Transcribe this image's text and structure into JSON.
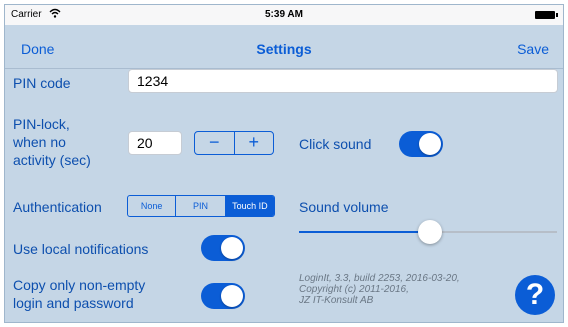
{
  "statusbar": {
    "carrier": "Carrier",
    "time": "5:39 AM"
  },
  "nav": {
    "left": "Done",
    "title": "Settings",
    "right": "Save"
  },
  "pin_code": {
    "label": "PIN code",
    "value": "1234"
  },
  "pin_lock": {
    "label_lines": [
      "PIN-lock,",
      "when no",
      "activity (sec)"
    ],
    "value": "20",
    "minus": "−",
    "plus": "+"
  },
  "click_sound": {
    "label": "Click sound",
    "on": true
  },
  "authentication": {
    "label": "Authentication",
    "options": [
      "None",
      "PIN",
      "Touch ID"
    ],
    "selected": "Touch ID"
  },
  "sound_volume": {
    "label": "Sound volume",
    "level": 0.45
  },
  "local_notifications": {
    "label": "Use local notifications",
    "on": true
  },
  "copy_nonempty": {
    "label_lines": [
      "Copy only non-empty",
      "login and password"
    ],
    "on": true
  },
  "about": {
    "lines": [
      "LoginIt, 3.3, build 2253, 2016-03-20,",
      "Copyright (c) 2011-2016,",
      "JZ IT-Konsult AB"
    ]
  },
  "help": {
    "label": "?"
  },
  "colors": {
    "accent": "#0b5dd6",
    "background": "#c5d6e6"
  }
}
